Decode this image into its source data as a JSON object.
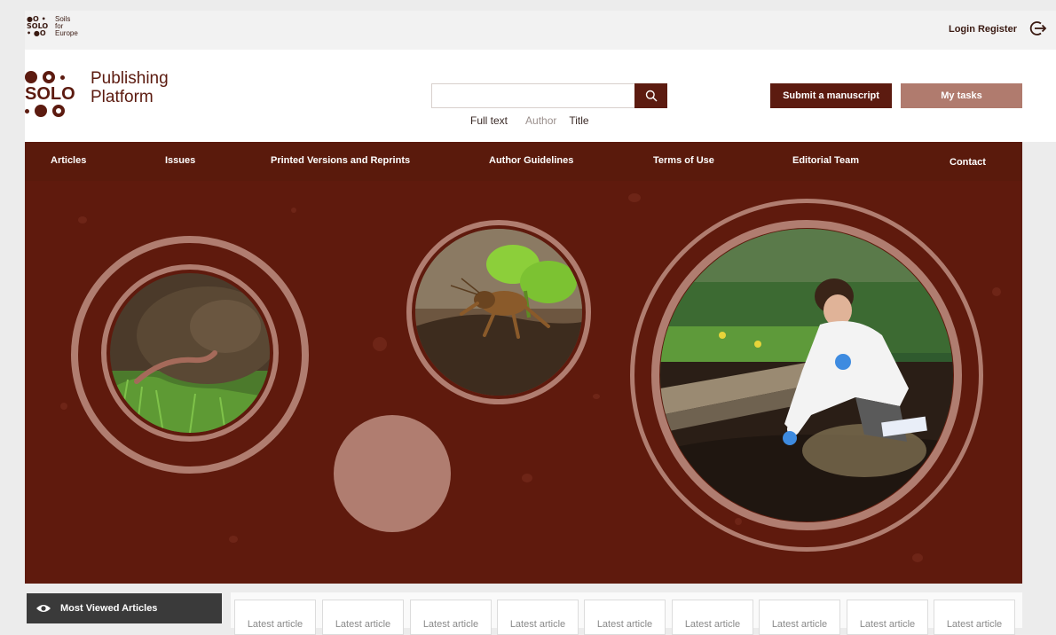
{
  "topbar": {
    "small_logo_marks": "●O •\nSOLO\n• ●O",
    "small_logo_text": "Soils\nfor\nEurope",
    "login_register": "Login Register",
    "logout_icon": "logout-icon"
  },
  "header": {
    "logo_word": "SOLO",
    "logo_title_line1": "Publishing",
    "logo_title_line2": "Platform",
    "search": {
      "placeholder": "",
      "value": "",
      "button_icon": "search-icon",
      "modes": [
        "Full text",
        "Author",
        "Title"
      ],
      "active_modes": [
        "Full text",
        "Title"
      ]
    },
    "submit_label": "Submit a manuscript",
    "tasks_label": "My tasks"
  },
  "nav": {
    "items": [
      "Articles",
      "Issues",
      "Printed Versions and Reprints",
      "Author Guidelines",
      "Terms of Use",
      "Editorial Team",
      "Contact"
    ]
  },
  "hero": {
    "images": [
      "earthworm-photo",
      "mole-cricket-photo",
      "scientist-photo"
    ]
  },
  "bottom": {
    "most_viewed_label": "Most Viewed Articles",
    "eye_icon": "eye-icon",
    "latest_cards": [
      "Latest article",
      "Latest article",
      "Latest article",
      "Latest article",
      "Latest article",
      "Latest article",
      "Latest article",
      "Latest article",
      "Latest article"
    ]
  },
  "colors": {
    "brand_dark": "#5c1b10",
    "nav_bg": "#5a1a0c",
    "hero_bg": "#5f1a0d",
    "ring": "#b07d70",
    "tasks_btn": "#b07b6e"
  }
}
